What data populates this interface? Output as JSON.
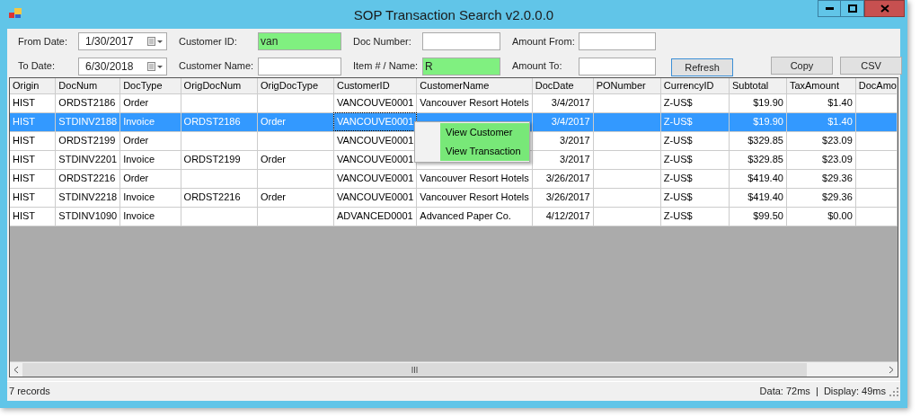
{
  "window": {
    "title": "SOP Transaction Search v2.0.0.0"
  },
  "filters": [
    {
      "label": "From Date:",
      "value": "1/30/2017",
      "kind": "date",
      "highlighted": false
    },
    {
      "label": "Customer ID:",
      "value": "van",
      "kind": "text",
      "highlighted": true
    },
    {
      "label": "Doc Number:",
      "kind": "text",
      "highlighted": false
    },
    {
      "label": "Amount From:",
      "kind": "text",
      "highlighted": false
    },
    {
      "label": "To Date:",
      "value": "6/30/2018",
      "kind": "date",
      "highlighted": false
    },
    {
      "label": "Customer Name:",
      "kind": "text",
      "highlighted": false
    },
    {
      "label": "Item # / Name:",
      "value": "R",
      "kind": "text",
      "highlighted": true
    },
    {
      "label": "Amount To:",
      "kind": "text",
      "highlighted": false
    }
  ],
  "buttons": [
    {
      "label": "Refresh",
      "focused": true
    },
    {
      "label": "Copy",
      "focused": false
    },
    {
      "label": "CSV",
      "focused": false
    }
  ],
  "table": {
    "columns": [
      "Origin",
      "DocNum",
      "DocType",
      "OrigDocNum",
      "OrigDocType",
      "CustomerID",
      "CustomerName",
      "DocDate",
      "PONumber",
      "CurrencyID",
      "Subtotal",
      "TaxAmount",
      "DocAmo"
    ],
    "rows": [
      {
        "selected": false,
        "cells": [
          "HIST",
          "ORDST2186",
          "Order",
          "",
          "",
          "VANCOUVE0001",
          "Vancouver Resort Hotels",
          "3/4/2017",
          "",
          "Z-US$",
          "$19.90",
          "$1.40",
          ""
        ]
      },
      {
        "selected": true,
        "cells": [
          "HIST",
          "STDINV2188",
          "Invoice",
          "ORDST2186",
          "Order",
          "VANCOUVE0001",
          "",
          "3/4/2017",
          "",
          "Z-US$",
          "$19.90",
          "$1.40",
          ""
        ]
      },
      {
        "selected": false,
        "cells": [
          "HIST",
          "ORDST2199",
          "Order",
          "",
          "",
          "VANCOUVE0001",
          "",
          "3/2017",
          "",
          "Z-US$",
          "$329.85",
          "$23.09",
          ""
        ]
      },
      {
        "selected": false,
        "cells": [
          "HIST",
          "STDINV2201",
          "Invoice",
          "ORDST2199",
          "Order",
          "VANCOUVE0001",
          "",
          "3/2017",
          "",
          "Z-US$",
          "$329.85",
          "$23.09",
          ""
        ]
      },
      {
        "selected": false,
        "cells": [
          "HIST",
          "ORDST2216",
          "Order",
          "",
          "",
          "VANCOUVE0001",
          "Vancouver Resort Hotels",
          "3/26/2017",
          "",
          "Z-US$",
          "$419.40",
          "$29.36",
          ""
        ]
      },
      {
        "selected": false,
        "cells": [
          "HIST",
          "STDINV2218",
          "Invoice",
          "ORDST2216",
          "Order",
          "VANCOUVE0001",
          "Vancouver Resort Hotels",
          "3/26/2017",
          "",
          "Z-US$",
          "$419.40",
          "$29.36",
          ""
        ]
      },
      {
        "selected": false,
        "cells": [
          "HIST",
          "STDINV1090",
          "Invoice",
          "",
          "",
          "ADVANCED0001",
          "Advanced Paper Co.",
          "4/12/2017",
          "",
          "Z-US$",
          "$99.50",
          "$0.00",
          ""
        ]
      }
    ]
  },
  "context_menu": [
    "View Customer",
    "View Transaction"
  ],
  "status_bar": {
    "records": "7 records",
    "timing": "Data: 72ms  |  Display: 49ms"
  }
}
